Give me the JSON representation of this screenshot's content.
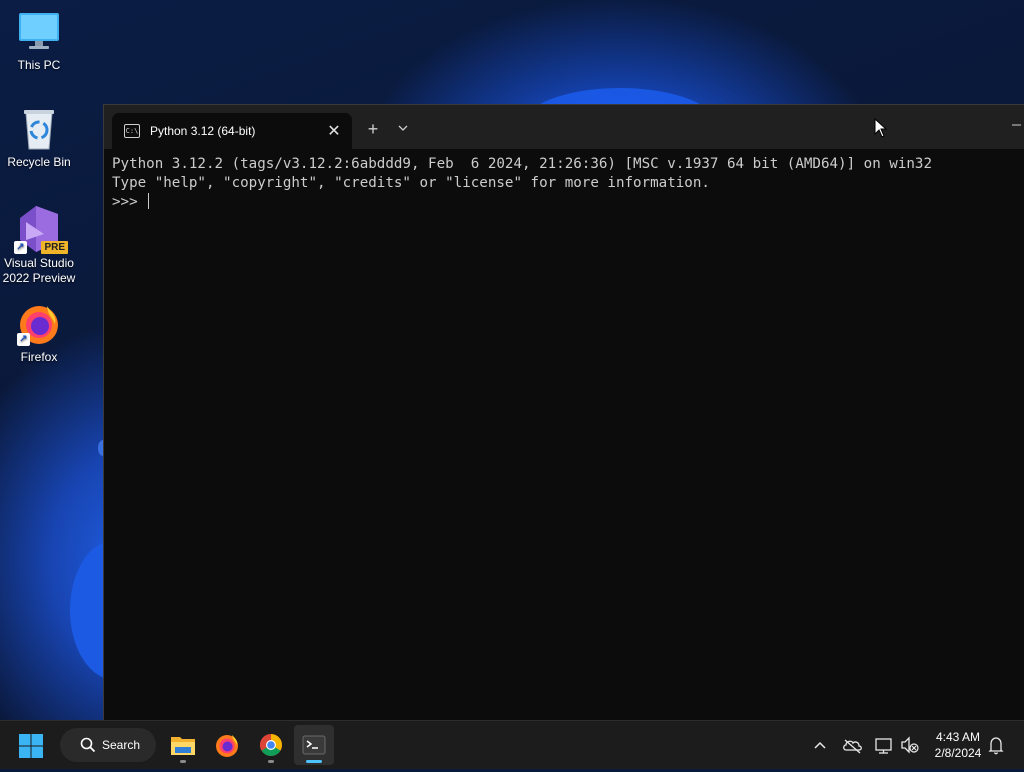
{
  "desktop": {
    "icons": [
      {
        "label": "This PC"
      },
      {
        "label": "Recycle Bin"
      },
      {
        "label": "Visual Studio 2022 Preview",
        "badge": "PRE"
      },
      {
        "label": "Firefox"
      }
    ]
  },
  "terminal": {
    "tab_title": "Python 3.12 (64-bit)",
    "tab_icon_text": "C:\\",
    "close_glyph": "✕",
    "new_tab_glyph": "+",
    "lines": [
      "Python 3.12.2 (tags/v3.12.2:6abddd9, Feb  6 2024, 21:26:36) [MSC v.1937 64 bit (AMD64)] on win32",
      "Type \"help\", \"copyright\", \"credits\" or \"license\" for more information."
    ],
    "prompt": ">>> "
  },
  "taskbar": {
    "search_label": "Search",
    "apps": [
      "file-explorer-icon",
      "firefox-icon",
      "chrome-icon",
      "terminal-icon"
    ],
    "active_app": "terminal-icon",
    "clock": {
      "time": "4:43 AM",
      "date": "2/8/2024"
    }
  },
  "colors": {
    "terminal_bg": "#0c0c0c",
    "titlebar_bg": "#202020",
    "taskbar_bg": "#1c1c1c",
    "accent": "#4cc2ff"
  }
}
